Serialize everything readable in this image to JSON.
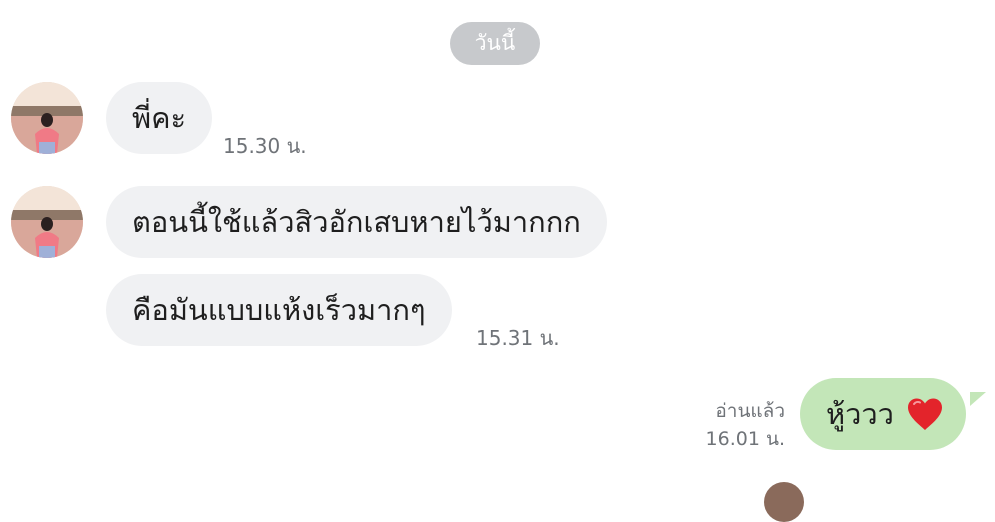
{
  "date_divider": "วันนี้",
  "messages": [
    {
      "text": "พี่คะ",
      "time": "15.30 น."
    },
    {
      "text": "ตอนนี้ใช้แล้วสิวอักเสบหายไว้มากกก"
    },
    {
      "text": "คือมันแบบแห้งเร็วมากๆ",
      "time": "15.31 น."
    }
  ],
  "outgoing": {
    "text": "หู้ววว",
    "emoji": "red-heart-icon",
    "read_label": "อ่านแล้ว",
    "time": "16.01 น."
  },
  "colors": {
    "incoming_bubble": "#f0f1f3",
    "outgoing_bubble": "#c3e6b8",
    "date_pill": "#c7c9cc",
    "meta_text": "#6f7378"
  }
}
